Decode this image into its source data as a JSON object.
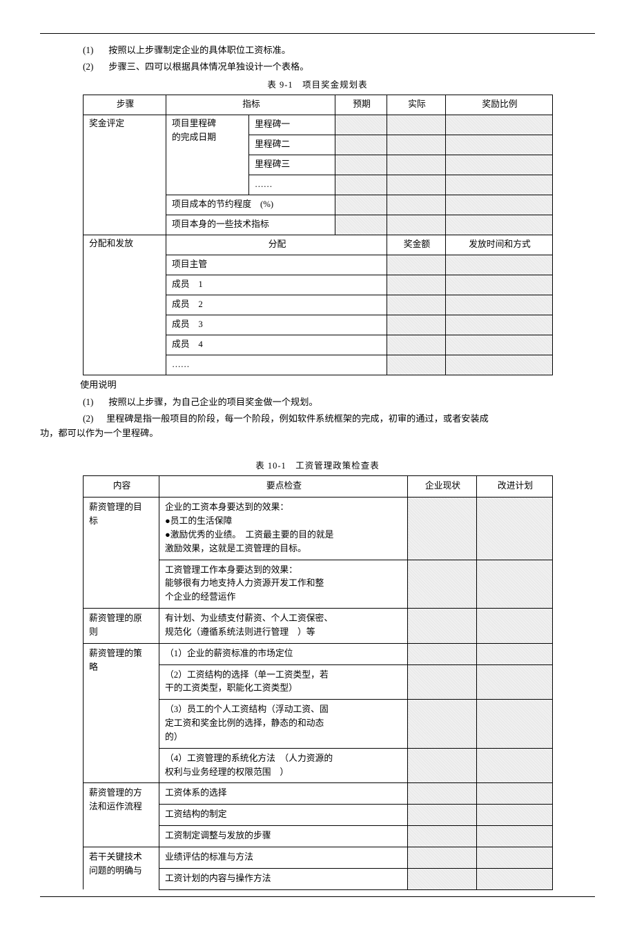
{
  "intro": {
    "item1_num": "(1)",
    "item1_text": "按照以上步骤制定企业的具体职位工资标准。",
    "item2_num": "(2)",
    "item2_text": "步骤三、四可以根据具体情况单独设计一个表格。"
  },
  "table9": {
    "caption": "表 9-1　项目奖金规划表",
    "h_step": "步骤",
    "h_indicator": "指标",
    "h_expected": "预期",
    "h_actual": "实际",
    "h_ratio": "奖励比例",
    "r1_step": "奖金评定",
    "r1_ind_a": "项目里程碑",
    "r1_ind_b": "的完成日期",
    "r1_m1": "里程碑一",
    "r1_m2": "里程碑二",
    "r1_m3": "里程碑三",
    "r1_dots": "……",
    "r1_cost": "项目成本的节约程度　(%)",
    "r1_tech": "项目本身的一些技术指标",
    "r2_step": "分配和发放",
    "r2_alloc": "分配",
    "r2_amount": "奖金额",
    "r2_payout": "发放时间和方式",
    "r2_m0": "项目主管",
    "r2_m1": "成员　1",
    "r2_m2": "成员　2",
    "r2_m3": "成员　3",
    "r2_m4": "成员　4",
    "r2_dots": "……"
  },
  "usage": {
    "title": "使用说明",
    "item1_num": "(1)",
    "item1_text": "按照以上步骤，为自己企业的项目奖金做一个规划。",
    "item2_num": "(2)",
    "item2_text_line1": "里程碑是指一般项目的阶段，每一个阶段，例如软件系统框架的完成，初审的通过，或者安装成",
    "item2_text_line2": "功，都可以作为一个里程碑。"
  },
  "table10": {
    "caption": "表 10-1　工资管理政策检查表",
    "h_content": "内容",
    "h_check": "要点检查",
    "h_status": "企业现状",
    "h_plan": "改进计划",
    "sec1_name_a": "薪资管理的目",
    "sec1_name_b": "标",
    "sec1_c1_l1": "企业的工资本身要达到的效果：",
    "sec1_c1_l2": "●员工的生活保障",
    "sec1_c1_l3": "●激励优秀的业绩。　工资最主要的目的就是",
    "sec1_c1_l4": "激励效果，这就是工资管理的目标。",
    "sec1_c2_l1": "工资管理工作本身要达到的效果：",
    "sec1_c2_l2": "能够很有力地支持人力资源开发工作和整",
    "sec1_c2_l3": "个企业的经营运作",
    "sec2_name_a": "薪资管理的原",
    "sec2_name_b": "则",
    "sec2_c1_l1": "有计划、为业绩支付薪资、个人工资保密、",
    "sec2_c1_l2": "规范化（遵循系统法则进行管理　）等",
    "sec3_name_a": "薪资管理的策",
    "sec3_name_b": "略",
    "sec3_c1": "（1）企业的薪资标准的市场定位",
    "sec3_c2_l1": "（2）工资结构的选择（单一工资类型，若",
    "sec3_c2_l2": "干的工资类型，职能化工资类型）",
    "sec3_c3_l1": "（3）员工的个人工资结构（浮动工资、固",
    "sec3_c3_l2": "定工资和奖金比例的选择，静态的和动态",
    "sec3_c3_l3": "的）",
    "sec3_c4_l1": "（4）工资管理的系统化方法　（人力资源的",
    "sec3_c4_l2": "权利与业务经理的权限范围　）",
    "sec4_name_a": "薪资管理的方",
    "sec4_name_b": "法和运作流程",
    "sec4_c1": "工资体系的选择",
    "sec4_c2": "工资结构的制定",
    "sec4_c3": "工资制定调整与发放的步骤",
    "sec5_name_a": "若干关键技术",
    "sec5_name_b": "问题的明确与",
    "sec5_c1": "业绩评估的标准与方法",
    "sec5_c2": "工资计划的内容与操作方法"
  }
}
